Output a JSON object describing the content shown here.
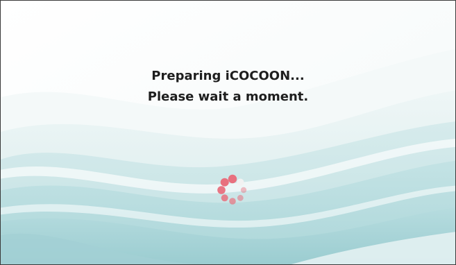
{
  "loading_screen": {
    "message_line1": "Preparing iCOCOON...",
    "message_line2": "Please wait a moment."
  },
  "spinner": {
    "icon": "loading-spinner-icon",
    "dot_color": "#e8707e",
    "inactive_dot_color": "#f2f2f2"
  },
  "colors": {
    "background": "#ffffff",
    "wave_light": "#e6f3f3",
    "wave_mid": "#bfe1e2",
    "wave_dark": "#9fd0d3",
    "text": "#1e1e1e"
  }
}
